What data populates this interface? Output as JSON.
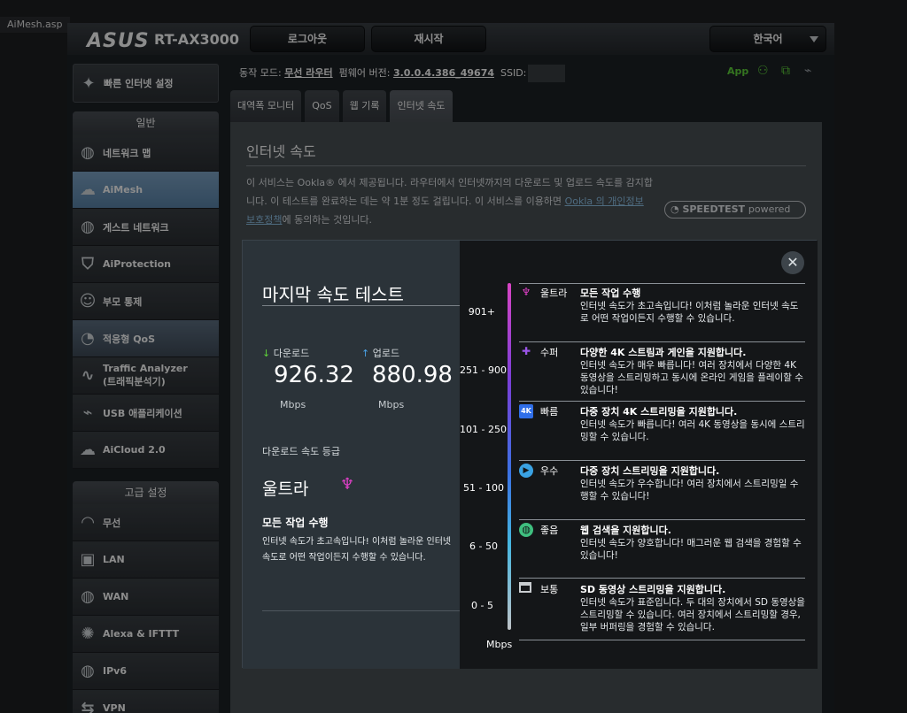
{
  "browser": {
    "tab_title": "AiMesh.asp"
  },
  "header": {
    "logo": "ASUS",
    "model": "RT-AX3000",
    "logout": "로그아웃",
    "reboot": "재시작",
    "language": "한국어"
  },
  "status": {
    "mode_label": "동작 모드:",
    "mode_value": "무선 라우터",
    "fw_label": "펌웨어 버전:",
    "fw_value": "3.0.0.4.386_49674",
    "ssid_label": "SSID:",
    "app": "App"
  },
  "sidebar": {
    "quick": "빠른 인터넷 설정",
    "general_head": "일반",
    "general": [
      {
        "label": "네트워크 맵"
      },
      {
        "label": "AiMesh"
      },
      {
        "label": "게스트 네트워크"
      },
      {
        "label": "AiProtection"
      },
      {
        "label": "부모 통제"
      },
      {
        "label": "적응형 QoS"
      },
      {
        "label": "Traffic Analyzer",
        "label2": "(트래픽분석기)"
      },
      {
        "label": "USB 애플리케이션"
      },
      {
        "label": "AiCloud 2.0"
      }
    ],
    "advanced_head": "고급 설정",
    "advanced": [
      {
        "label": "무선"
      },
      {
        "label": "LAN"
      },
      {
        "label": "WAN"
      },
      {
        "label": "Alexa & IFTTT"
      },
      {
        "label": "IPv6"
      },
      {
        "label": "VPN"
      }
    ]
  },
  "tabs": [
    "대역폭 모니터",
    "QoS",
    "웹 기록",
    "인터넷 속도"
  ],
  "panel": {
    "title": "인터넷 속도",
    "desc_1": "이 서비스는 Ookla® 에서 제공됩니다. 라우터에서 인터넷까지의 다운로드 및 업로드 속도를 감지합니다. 이 테스트를 완료하는 데는 약 1분 정도 걸립니다. 이 서비스를 이용하면 ",
    "desc_link": "Ookla 의 개인정보 보호정책",
    "desc_2": "에 동의하는 것입니다.",
    "speedtest": "SPEEDTEST",
    "powered": "powered"
  },
  "modal": {
    "title": "마지막 속도 테스트",
    "download_label": "다운로드",
    "upload_label": "업로드",
    "download_value": "926.32",
    "upload_value": "880.98",
    "unit": "Mbps",
    "grade_label": "다운로드 속도 등급",
    "grade": "울트라",
    "grade_title": "모든 작업 수행",
    "grade_desc": "인터넷 속도가 초고속입니다! 이처럼 놀라운 인터넷 속도로 어떤 작업이든지 수행할 수 있습니다.",
    "scale_unit": "Mbps",
    "tiers": [
      {
        "range": "901+",
        "name": "울트라",
        "head": "모든 작업 수행",
        "desc": "인터넷 속도가 초고속입니다! 이처럼 놀라운 인터넷 속도로 어떤 작업이든지 수행할 수 있습니다.",
        "icon": "rocket-icon",
        "color": "#e040c8"
      },
      {
        "range": "251 - 900",
        "name": "수퍼",
        "head": "다양한 4K 스트림과 게인을 지원합니다.",
        "desc": "인터넷 속도가 매우 빠릅니다! 여러 장치에서 다양한 4K 동영상을 스트리밍하고 동시에 온라인 게임을 플레이할 수 있습니다!",
        "icon": "gamepad-icon",
        "color": "#9b55e8"
      },
      {
        "range": "101 - 250",
        "name": "빠름",
        "head": "다중 장치 4K 스트리밍을 지원합니다.",
        "desc": "인터넷 속도가 빠릅니다! 여러 4K 동영상을 동시에 스트리밍할 수 있습니다.",
        "icon": "4k-icon",
        "color": "#2f6ee8"
      },
      {
        "range": "51 - 100",
        "name": "우수",
        "head": "다중 장치 스트리밍을 지원합니다.",
        "desc": "인터넷 속도가 우수합니다! 여러 장치에서 스트리밍일 수 행할 수 있습니다!",
        "icon": "play-icon",
        "color": "#3aa2e3"
      },
      {
        "range": "6 - 50",
        "name": "좋음",
        "head": "웹 검색을 지원합니다.",
        "desc": "인터넷 속도가 양호합니다! 매그러운 웹 검색을 경험할 수 있습니다!",
        "icon": "globe-icon",
        "color": "#3fbf7f"
      },
      {
        "range": "0 - 5",
        "name": "보통",
        "head": "SD 동영상 스트리밍을 지원합니다.",
        "desc": "인터넷 속도가 표준입니다. 두 대의 장치에서 SD 동영상을 스트리밍할 수 있습니다. 여러 장치에서 스트리밍할 경우, 일부 버퍼링을 경험할 수 있습니다.",
        "icon": "window-icon",
        "color": "#c9cdd0"
      }
    ]
  }
}
